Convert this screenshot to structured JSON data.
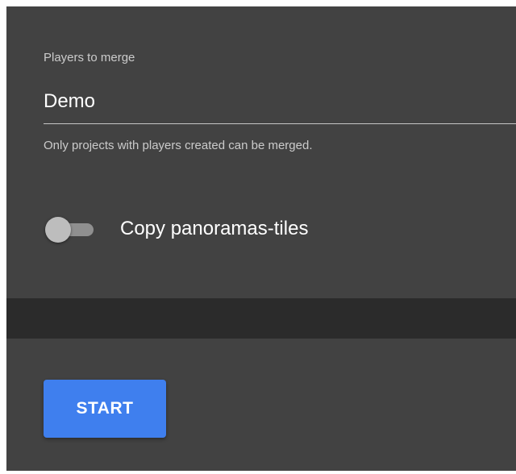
{
  "merge_form": {
    "players_field": {
      "label": "Players to merge",
      "value": "Demo",
      "hint": "Only projects with players created can be merged."
    },
    "copy_tiles_toggle": {
      "label": "Copy panoramas-tiles",
      "checked": false
    }
  },
  "actions": {
    "start_label": "START"
  },
  "colors": {
    "card_background": "#424242",
    "page_background": "#2a2a2a",
    "primary_button": "#3f7fee",
    "toggle_thumb": "#bdbdbd",
    "toggle_track": "#8f8f8f"
  }
}
